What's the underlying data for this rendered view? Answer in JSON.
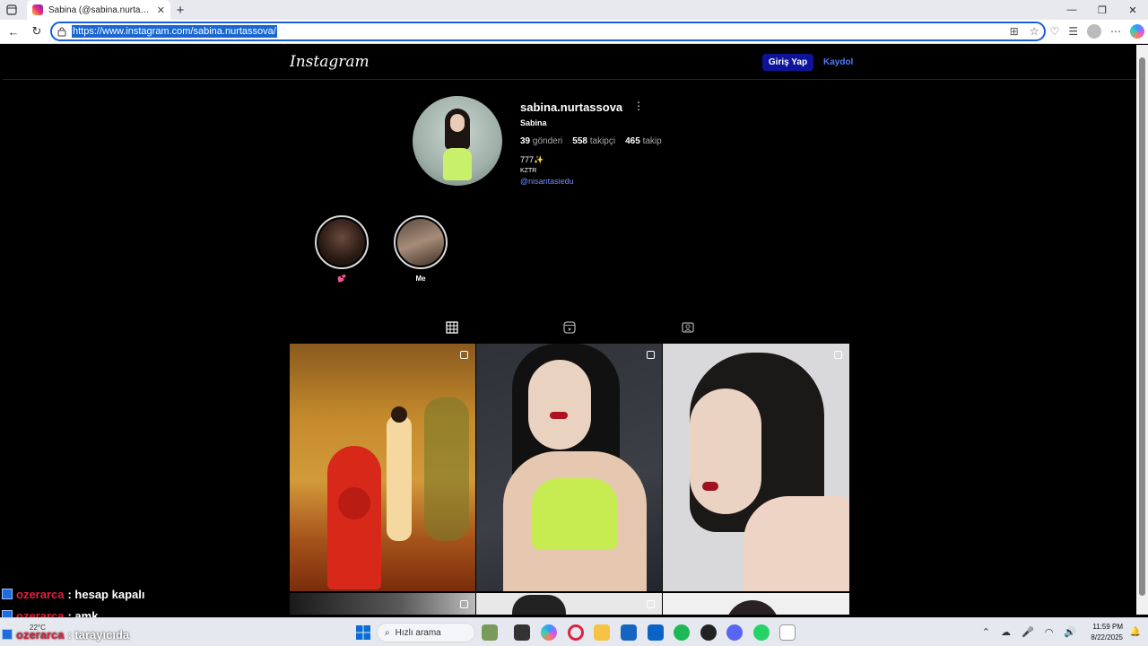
{
  "browser": {
    "tab_title": "Sabina (@sabina.nurtassova) • Ins",
    "tab_close": "✕",
    "url": "https://www.instagram.com/sabina.nurtassova/"
  },
  "instagram": {
    "logo": "Instagram",
    "login_label": "Giriş Yap",
    "signup_label": "Kaydol"
  },
  "profile": {
    "username": "sabina.nurtassova",
    "more": "⋮",
    "full_name": "Sabina",
    "posts_count": "39",
    "posts_label": "gönderi",
    "followers_count": "558",
    "followers_label": "takipçi",
    "following_count": "465",
    "following_label": "takip",
    "bio_line1": "777✨",
    "bio_line2": "KZTR",
    "bio_link": "@nisantasiedu"
  },
  "highlights": [
    {
      "label": "💕"
    },
    {
      "label": "Me"
    }
  ],
  "chat": [
    {
      "user": "ozerarca",
      "text": ": hesap kapalı"
    },
    {
      "user": "ozerarca",
      "text": ": amk"
    },
    {
      "user": "ozerarca",
      "text": ": tarayıcıda"
    }
  ],
  "taskbar": {
    "weather": "22°C",
    "search_placeholder": "Hızlı arama",
    "time": "11:59 PM",
    "date": "8/22/2025"
  }
}
